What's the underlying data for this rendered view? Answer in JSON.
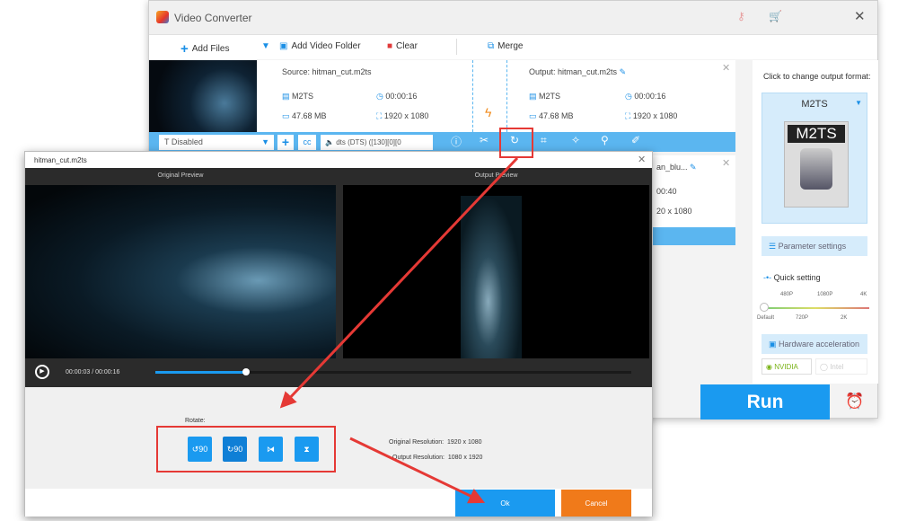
{
  "app": {
    "title": "Video Converter"
  },
  "toolbar": {
    "add_files": "Add Files",
    "add_folder": "Add Video Folder",
    "clear": "Clear",
    "merge": "Merge"
  },
  "file1": {
    "source": "Source: hitman_cut.m2ts",
    "output": "Output: hitman_cut.m2ts",
    "src_format": "M2TS",
    "src_duration": "00:00:16",
    "src_size": "47.68 MB",
    "src_resolution": "1920 x 1080",
    "out_format": "M2TS",
    "out_duration": "00:00:16",
    "out_size": "47.68 MB",
    "out_resolution": "1920 x 1080",
    "subtitle": "Disabled",
    "audio": "dts (DTS) ([130][0][0"
  },
  "file2": {
    "output": "an_blu...",
    "duration": "00:40",
    "resolution": "20 x 1080"
  },
  "right": {
    "hint": "Click to change output format:",
    "format": "M2TS",
    "format_icon_text": "M2TS",
    "param": "Parameter settings",
    "quick": "Quick setting",
    "top_labels": [
      "480P",
      "1080P",
      "4K"
    ],
    "bottom_labels": [
      "Default",
      "720P",
      "2K"
    ],
    "hw": "Hardware acceleration",
    "nvidia": "NVIDIA",
    "intel": "Intel",
    "run": "Run"
  },
  "dialog": {
    "title": "hitman_cut.m2ts",
    "original_preview": "Original Preview",
    "output_preview": "Output Preview",
    "current_time": "00:00:03",
    "total_time": "00:00:16",
    "time_sep": "/",
    "progress": 0.19,
    "rotate_label": "Rotate:",
    "rotate_left": "90",
    "rotate_right": "90",
    "orig_res_label": "Original Resolution:",
    "orig_res": "1920 x 1080",
    "out_res_label": "Output Resolution:",
    "out_res": "1080 x 1920",
    "ok": "Ok",
    "cancel": "Cancel"
  },
  "colors": {
    "accent": "#1a9af0",
    "bar": "#5bb6f0",
    "cancel": "#f07a1a",
    "highlight": "#e53935"
  }
}
